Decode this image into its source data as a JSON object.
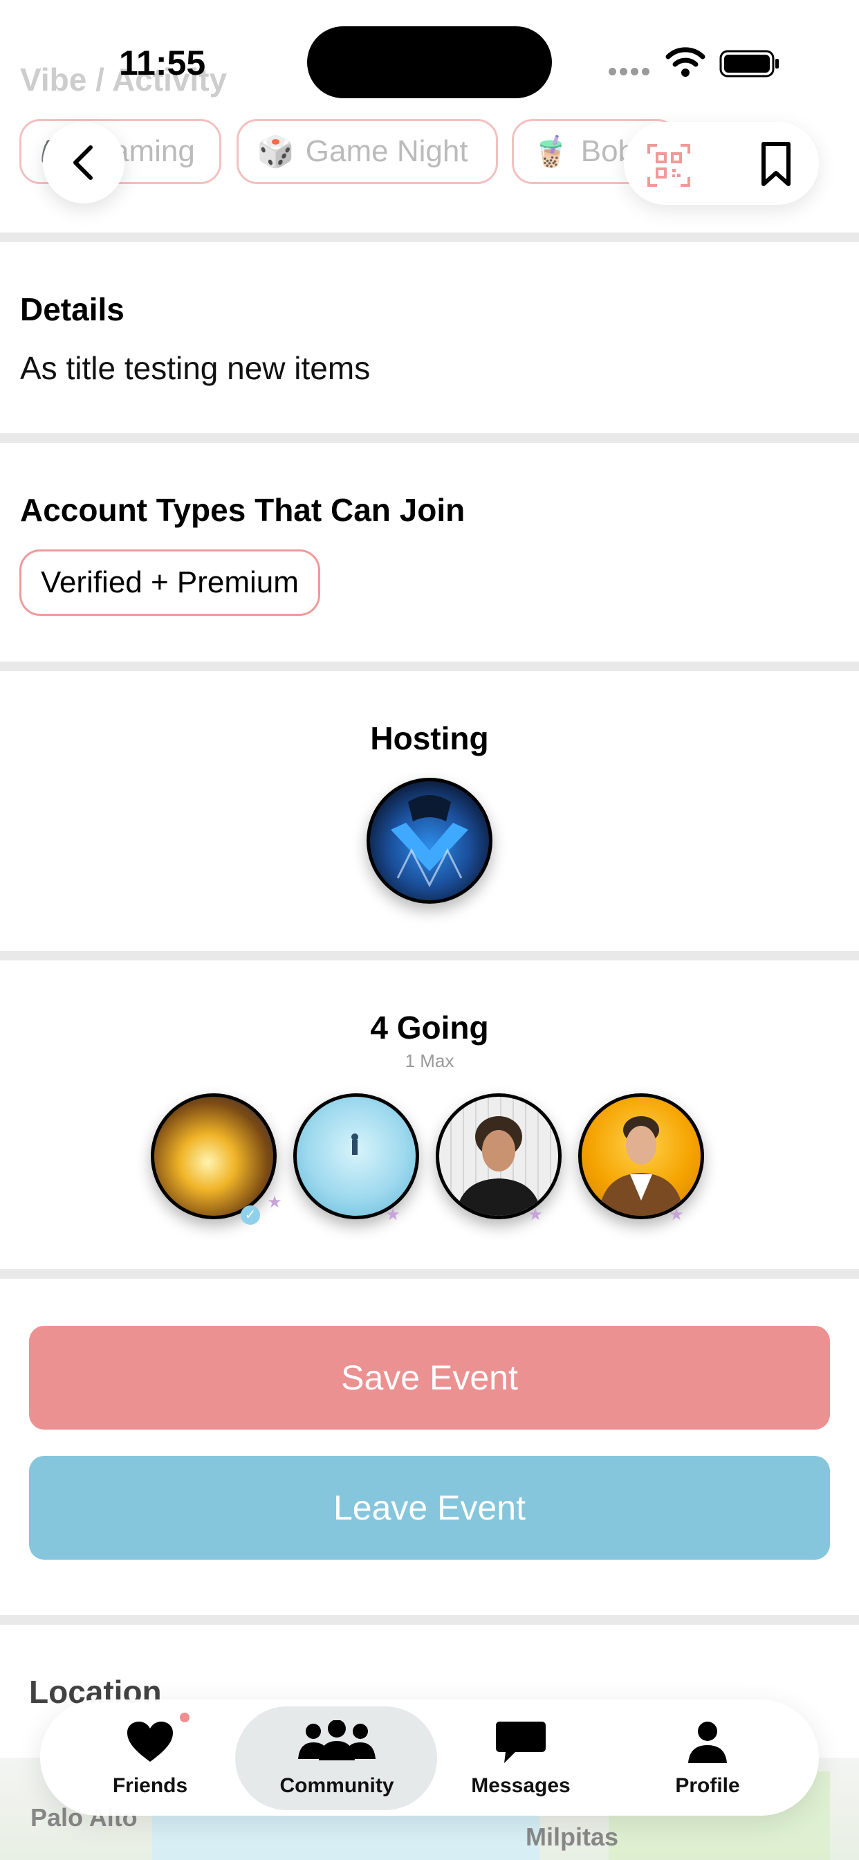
{
  "header": {
    "faded_title": "Vibe / Activity",
    "time": "11:55",
    "chips": [
      {
        "emoji": "🎮",
        "label": "Gaming"
      },
      {
        "emoji": "🎲",
        "label": "Game Night"
      },
      {
        "emoji": "🧋",
        "label": "Boba"
      }
    ]
  },
  "details": {
    "title": "Details",
    "text": "As title testing new items"
  },
  "account_types": {
    "title": "Account Types That Can Join",
    "tag": "Verified + Premium"
  },
  "hosting": {
    "title": "Hosting"
  },
  "going": {
    "title": "4 Going",
    "subtitle": "1 Max"
  },
  "actions": {
    "save_label": "Save Event",
    "leave_label": "Leave Event",
    "save_color": "#ec9191",
    "leave_color": "#85c6dd"
  },
  "location": {
    "title": "Location",
    "map_labels": [
      "Palo Alto",
      "Milpitas"
    ]
  },
  "tabbar": {
    "items": [
      {
        "label": "Friends",
        "icon": "heart-icon"
      },
      {
        "label": "Community",
        "icon": "people-icon"
      },
      {
        "label": "Messages",
        "icon": "chat-bubble-icon"
      },
      {
        "label": "Profile",
        "icon": "person-icon"
      }
    ],
    "active": "Community"
  }
}
